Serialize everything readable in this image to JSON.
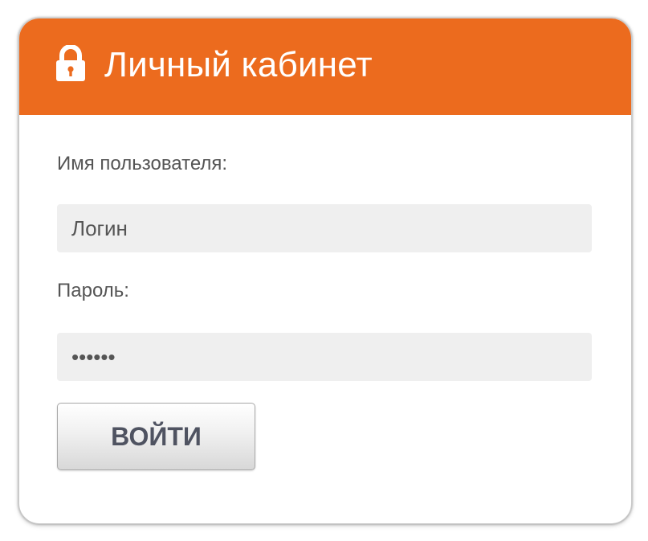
{
  "header": {
    "icon": "lock-icon",
    "title": "Личный кабинет",
    "background_color": "#ec6b1e"
  },
  "form": {
    "username_label": "Имя пользователя:",
    "username_placeholder": "Логин",
    "password_label": "Пароль:",
    "password_value": "••••••",
    "submit_label": "ВОЙТИ"
  }
}
